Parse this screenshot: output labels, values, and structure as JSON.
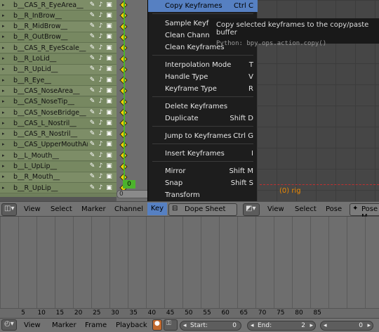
{
  "channels": [
    {
      "name": "b__CAS_R_EyeArea__"
    },
    {
      "name": "b__R_InBrow__"
    },
    {
      "name": "b__R_MidBrow__"
    },
    {
      "name": "b__R_OutBrow__"
    },
    {
      "name": "b__CAS_R_EyeScale__"
    },
    {
      "name": "b__R_LoLid__"
    },
    {
      "name": "b__R_UpLid__"
    },
    {
      "name": "b__R_Eye__"
    },
    {
      "name": "b__CAS_NoseArea__"
    },
    {
      "name": "b__CAS_NoseTip__"
    },
    {
      "name": "b__CAS_NoseBridge__"
    },
    {
      "name": "b__CAS_L_Nostril__"
    },
    {
      "name": "b__CAS_R_Nostril__"
    },
    {
      "name": "b__CAS_UpperMouthArea__"
    },
    {
      "name": "b__L_Mouth__"
    },
    {
      "name": "b__L_UpLip__"
    },
    {
      "name": "b__R_Mouth__"
    },
    {
      "name": "b__R_UpLip__"
    }
  ],
  "channel_icons": {
    "wrench": "wrench-icon",
    "speaker": "speaker-icon",
    "lock": "lock-icon"
  },
  "current_frame": "0",
  "zero_label": "0",
  "menu": {
    "items": [
      {
        "label": "Copy Keyframes",
        "shortcut": "Ctrl C",
        "highlighted": true
      },
      {
        "label": "Sample Keyframes",
        "shortcut": ""
      },
      {
        "label": "Clean Channels",
        "shortcut": ""
      },
      {
        "label": "Clean Keyframes",
        "shortcut": ""
      },
      {
        "label": "Interpolation Mode",
        "shortcut": "T"
      },
      {
        "label": "Handle Type",
        "shortcut": "V"
      },
      {
        "label": "Keyframe Type",
        "shortcut": "R"
      },
      {
        "label": "Delete Keyframes",
        "shortcut": ""
      },
      {
        "label": "Duplicate",
        "shortcut": "Shift D"
      },
      {
        "label": "Jump to Keyframes",
        "shortcut": "Ctrl G"
      },
      {
        "label": "Insert Keyframes",
        "shortcut": "I"
      },
      {
        "label": "Mirror",
        "shortcut": "Shift M"
      },
      {
        "label": "Snap",
        "shortcut": "Shift S"
      },
      {
        "label": "Transform",
        "shortcut": ""
      }
    ]
  },
  "tooltip": {
    "text": "Copy selected keyframes to the copy/paste buffer",
    "python": "Python: bpy.ops.action.copy()"
  },
  "viewport": {
    "object_label": "(0) rig"
  },
  "dopesheet_header": {
    "view": "View",
    "select": "Select",
    "marker": "Marker",
    "channel": "Channel",
    "key": "Key",
    "mode": "Dope Sheet",
    "right_view": "View",
    "right_select": "Select",
    "right_pose": "Pose",
    "right_mode": "Pose M"
  },
  "ruler_ticks": [
    "5",
    "10",
    "15",
    "20",
    "25",
    "30",
    "35",
    "40",
    "45",
    "50",
    "55",
    "60",
    "65",
    "70",
    "75",
    "80",
    "85"
  ],
  "timeline_footer": {
    "view": "View",
    "marker": "Marker",
    "frame": "Frame",
    "playback": "Playback",
    "start_label": "Start:",
    "start_value": "0",
    "end_label": "End:",
    "end_value": "2",
    "current": "0"
  },
  "colors": {
    "accent": "#5680c2",
    "keyframe": "#f0d000",
    "current_frame": "#4cb32c",
    "rig_label": "#f08a00"
  }
}
